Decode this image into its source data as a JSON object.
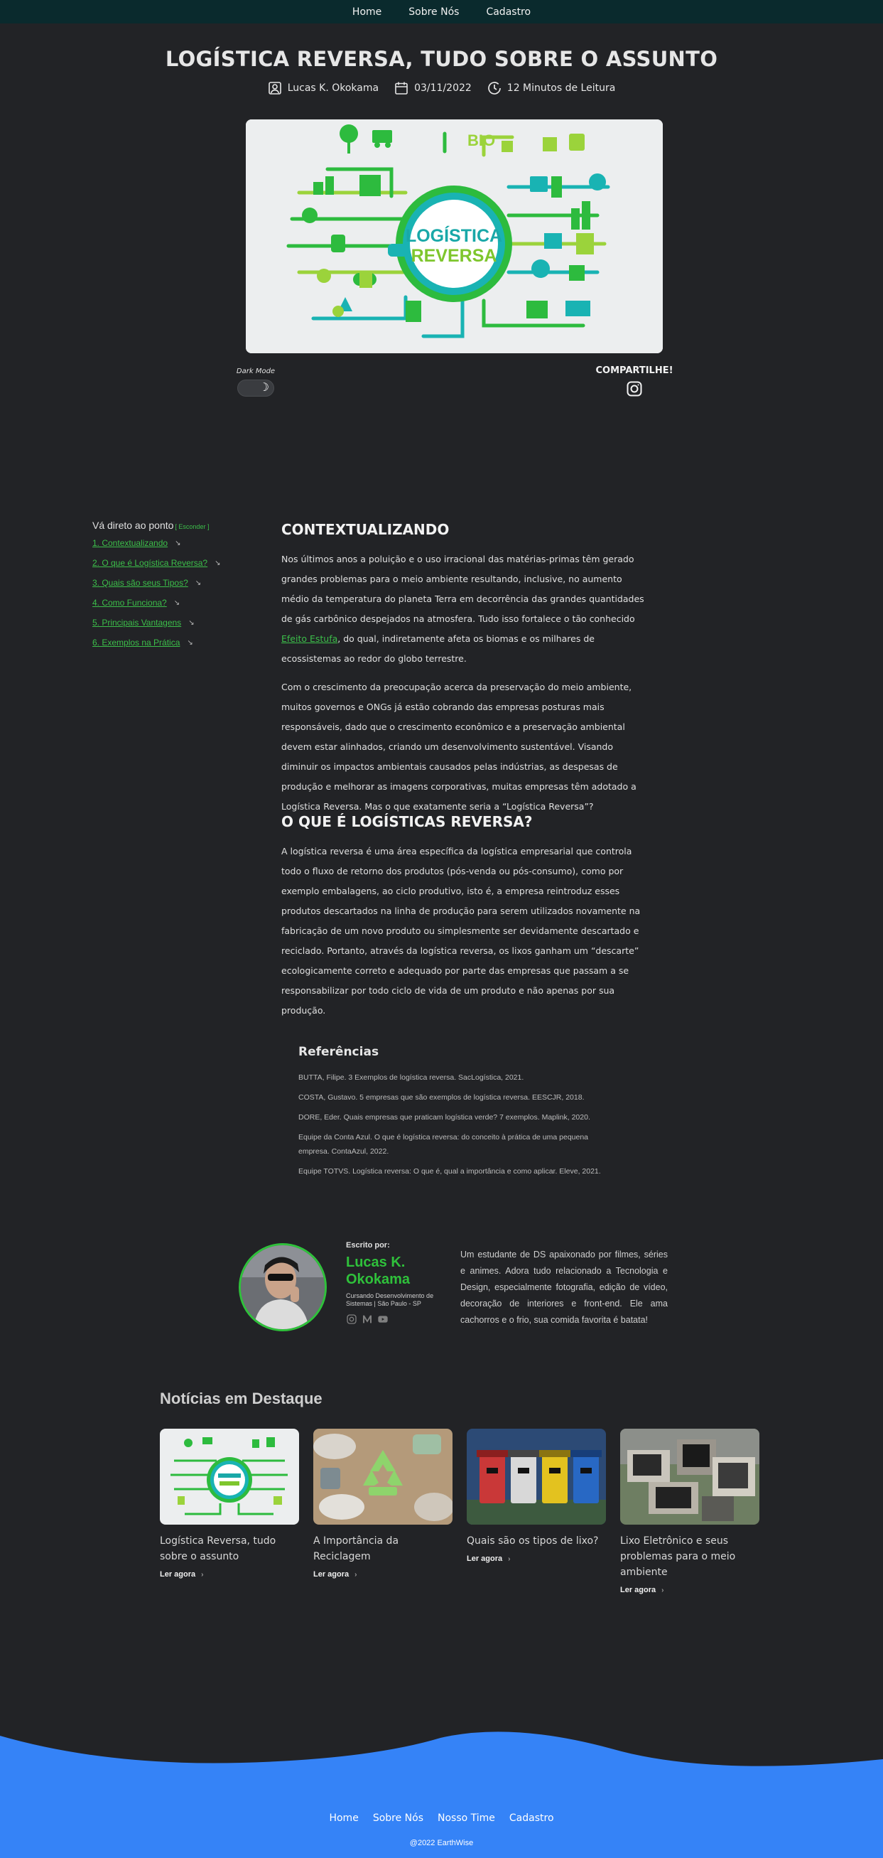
{
  "nav": {
    "items": [
      "Home",
      "Sobre Nós",
      "Cadastro"
    ]
  },
  "article": {
    "title": "LOGÍSTICA REVERSA, TUDO SOBRE O ASSUNTO",
    "author": "Lucas K. Okokama",
    "date": "03/11/2022",
    "read_time": "12 Minutos de Leitura",
    "hero_text_1": "LOGÍSTICA",
    "hero_text_2": "REVERSA",
    "hero_bio_text": "BIO"
  },
  "controls": {
    "dark_mode_label": "Dark Mode",
    "share_label": "COMPARTILHE!"
  },
  "toc": {
    "heading": "Vá direto ao ponto",
    "hide_label": "[ Esconder ]",
    "items": [
      "1. Contextualizando",
      "2. O que é Logística Reversa?",
      "3. Quais são seus Tipos?",
      "4. Como Funciona?",
      "5. Principais Vantagens",
      "6. Exemplos na Prática"
    ]
  },
  "sections": {
    "s1": {
      "heading": "CONTEXTUALIZANDO",
      "p1_before": "Nos últimos anos a poluição e o uso irracional das matérias-primas têm gerado grandes problemas para o meio ambiente resultando, inclusive, no aumento médio da temperatura do planeta Terra em decorrência das grandes quantidades de gás carbônico despejados na atmosfera. Tudo isso fortalece o tão conhecido ",
      "p1_link": "Efeito Estufa",
      "p1_after": ", do qual, indiretamente afeta os biomas e os milhares de ecossistemas ao redor do globo terrestre.",
      "p2": "Com o crescimento da preocupação acerca da preservação do meio ambiente, muitos governos e ONGs já estão cobrando das empresas posturas mais responsáveis, dado que o crescimento econômico e a preservação ambiental devem estar alinhados, criando um desenvolvimento sustentável. Visando diminuir os impactos ambientais causados pelas indústrias, as despesas de produção e melhorar as imagens corporativas, muitas empresas têm adotado a Logística Reversa. Mas o que exatamente seria a “Logística Reversa”?"
    },
    "s2": {
      "heading": "O QUE É LOGÍSTICAS REVERSA?",
      "p1": "A logística reversa é uma área específica da logística empresarial que controla todo o fluxo de retorno dos produtos (pós-venda ou pós-consumo), como por exemplo embalagens, ao ciclo produtivo, isto é, a empresa reintroduz esses produtos descartados na linha de produção para serem utilizados novamente na fabricação de um novo produto ou simplesmente ser devidamente descartado e reciclado. Portanto, através da logística reversa, os lixos ganham um “descarte” ecologicamente correto e adequado por parte das empresas que passam a se responsabilizar por todo ciclo de vida de um produto e não apenas por sua produção."
    }
  },
  "references": {
    "heading": "Referências",
    "items": [
      "BUTTA, Filipe. 3 Exemplos de logística reversa. SacLogística, 2021.",
      "COSTA, Gustavo. 5 empresas que são exemplos de logística reversa. EESCJR, 2018.",
      "DORE, Eder. Quais empresas que praticam logística verde? 7 exemplos. Maplink, 2020.",
      "Equipe da Conta Azul. O que é logística reversa: do conceito à prática de uma pequena empresa. ContaAzul, 2022.",
      "Equipe TOTVS. Logística reversa: O que é, qual a importância e como aplicar. Eleve, 2021."
    ]
  },
  "author_box": {
    "by_label": "Escrito por:",
    "name": "Lucas K. Okokama",
    "subtitle": "Cursando Desenvolvimento de Sistemas | São Paulo - SP",
    "bio": "Um estudante de DS apaixonado por filmes, séries e animes. Adora tudo relacionado a Tecnologia e Design, especialmente fotografia, edição de vídeo, decoração de interiores e front-end. Ele ama cachorros e o frio, sua comida favorita é batata!"
  },
  "news": {
    "heading": "Notícias em Destaque",
    "read_more": "Ler agora",
    "cards": [
      {
        "title": "Logística Reversa, tudo sobre o assunto",
        "thumb": "logistica-reversa-illustration"
      },
      {
        "title": "A Importância da Reciclagem",
        "thumb": "recycling-symbol-photo"
      },
      {
        "title": "Quais são os tipos de lixo?",
        "thumb": "colored-bins-photo"
      },
      {
        "title": "Lixo Eletrônico e seus problemas para o meio ambiente",
        "thumb": "e-waste-photo"
      }
    ]
  },
  "footer": {
    "links": [
      "Home",
      "Sobre Nós",
      "Nosso Time",
      "Cadastro"
    ],
    "copyright": "@2022 EarthWise"
  },
  "colors": {
    "background": "#222326",
    "topbar": "#0a2a2d",
    "accent_green": "#3cbf4a",
    "footer_blue": "#3583f7"
  }
}
